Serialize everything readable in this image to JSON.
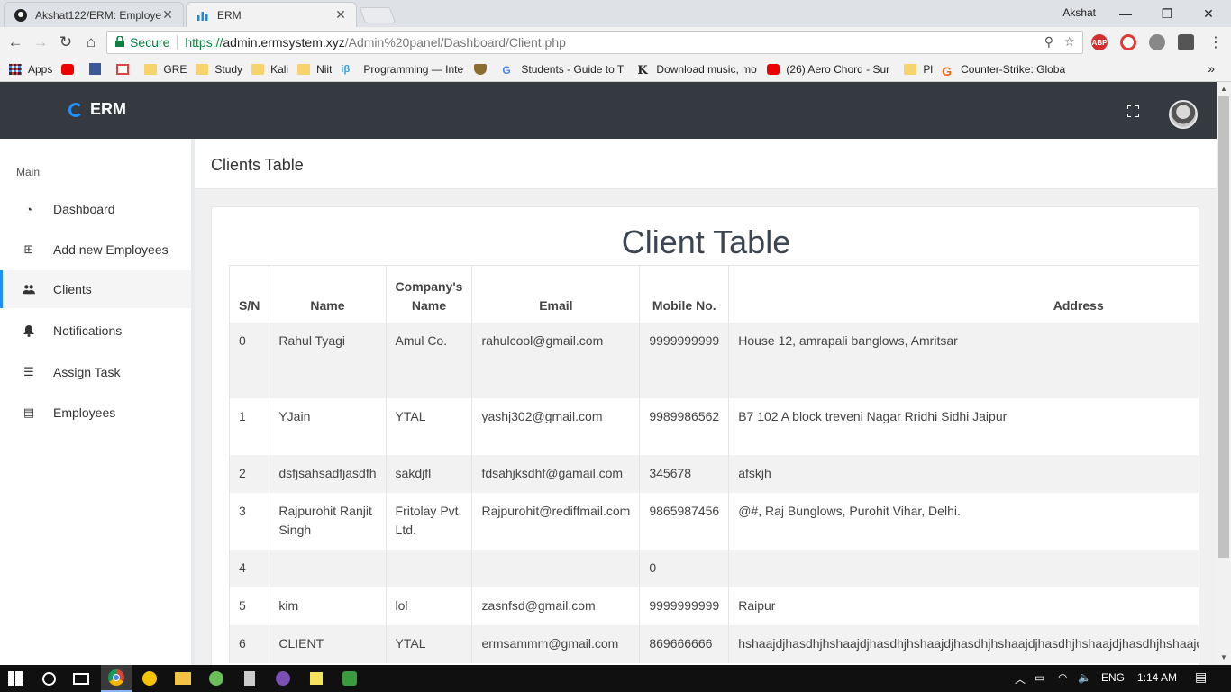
{
  "browser": {
    "tabs": [
      {
        "label": "Akshat122/ERM: Employe",
        "active": false,
        "icon": "github-icon"
      },
      {
        "label": "ERM",
        "active": true,
        "icon": "bar-chart-icon"
      }
    ],
    "user": "Akshat",
    "window_controls": {
      "minimize": "—",
      "restore": "❐",
      "close": "✕"
    },
    "secure_label": "Secure",
    "url": {
      "scheme": "https://",
      "host": "admin.ermsystem.xyz",
      "path": "/Admin%20panel/Dashboard/Client.php"
    },
    "extensions": [
      {
        "name": "abp-extension-icon",
        "text": "ABP",
        "color": "#d32f2f"
      },
      {
        "name": "opera-extension-icon",
        "text": "O",
        "color": "#e53935"
      },
      {
        "name": "wrench-extension-icon",
        "text": "",
        "color": "#777777"
      },
      {
        "name": "shield-extension-icon",
        "text": "",
        "color": "#555555"
      }
    ],
    "bookmarks": [
      {
        "label": "Apps",
        "icon": "apps-grid-icon"
      },
      {
        "label": "",
        "icon": "youtube-icon"
      },
      {
        "label": "",
        "icon": "facebook-icon"
      },
      {
        "label": "",
        "icon": "gmail-icon"
      },
      {
        "label": "GRE",
        "icon": "folder-icon"
      },
      {
        "label": "Study",
        "icon": "folder-icon"
      },
      {
        "label": "Kali",
        "icon": "folder-icon"
      },
      {
        "label": "Niit",
        "icon": "folder-icon"
      },
      {
        "label": "Programming — Inte",
        "icon": "ib-icon"
      },
      {
        "label": "",
        "icon": "shield-icon"
      },
      {
        "label": "Students - Guide to T",
        "icon": "google-icon"
      },
      {
        "label": "Download music, mo",
        "icon": "k-icon"
      },
      {
        "label": "(26) Aero Chord - Sur",
        "icon": "youtube-icon"
      },
      {
        "label": "Pl",
        "icon": "folder-icon"
      },
      {
        "label": "Counter-Strike: Globa",
        "icon": "g2a-icon"
      }
    ]
  },
  "app": {
    "brand": "ERM",
    "page_header": "Clients Table",
    "card_title": "Client Table"
  },
  "sidebar": {
    "section": "Main",
    "items": [
      {
        "label": "Dashboard",
        "icon": "dashboard-icon",
        "glyph": "◔",
        "active": false
      },
      {
        "label": "Add new Employees",
        "icon": "plus-square-icon",
        "glyph": "⊞",
        "active": false
      },
      {
        "label": "Clients",
        "icon": "users-icon",
        "glyph": "👥",
        "active": true
      },
      {
        "label": "Notifications",
        "icon": "bell-icon",
        "glyph": "🔔",
        "active": false
      },
      {
        "label": "Assign Task",
        "icon": "tasks-icon",
        "glyph": "☰",
        "active": false
      },
      {
        "label": "Employees",
        "icon": "id-card-icon",
        "glyph": "▤",
        "active": false
      }
    ]
  },
  "table": {
    "headers": [
      "S/N",
      "Name",
      "Company's Name",
      "Email",
      "Mobile No.",
      "Address"
    ],
    "rows": [
      [
        "0",
        "Rahul Tyagi",
        "Amul Co.",
        "rahulcool@gmail.com",
        "9999999999",
        "House 12, amrapali banglows, Amritsar"
      ],
      [
        "1",
        "YJain",
        "YTAL",
        "yashj302@gmail.com",
        "9989986562",
        "B7 102 A block treveni Nagar Rridhi Sidhi Jaipur"
      ],
      [
        "2",
        "dsfjsahsadfjasdfh",
        "sakdjfl",
        "fdsahjksdhf@gamail.com",
        "345678",
        "afskjh"
      ],
      [
        "3",
        "Rajpurohit Ranjit Singh",
        "Fritolay Pvt. Ltd.",
        "Rajpurohit@rediffmail.com",
        "9865987456",
        "@#, Raj Bunglows, Purohit Vihar, Delhi."
      ],
      [
        "4",
        "",
        "",
        "",
        "0",
        ""
      ],
      [
        "5",
        "kim",
        "lol",
        "zasnfsd@gmail.com",
        "9999999999",
        "Raipur"
      ],
      [
        "6",
        "CLIENT",
        "YTAL",
        "ermsammm@gmail.com",
        "869666666",
        "hshaajdjhasdhjhshaajdjhasdhjhshaajdjhasdhjhshaajdjhasdhjhshaajdjhasdhjhshaajdjhasdhjhshaajdjhasdhjhshaajdjhasdhjh"
      ]
    ]
  },
  "taskbar": {
    "language": "ENG",
    "time": "1:14 AM"
  }
}
